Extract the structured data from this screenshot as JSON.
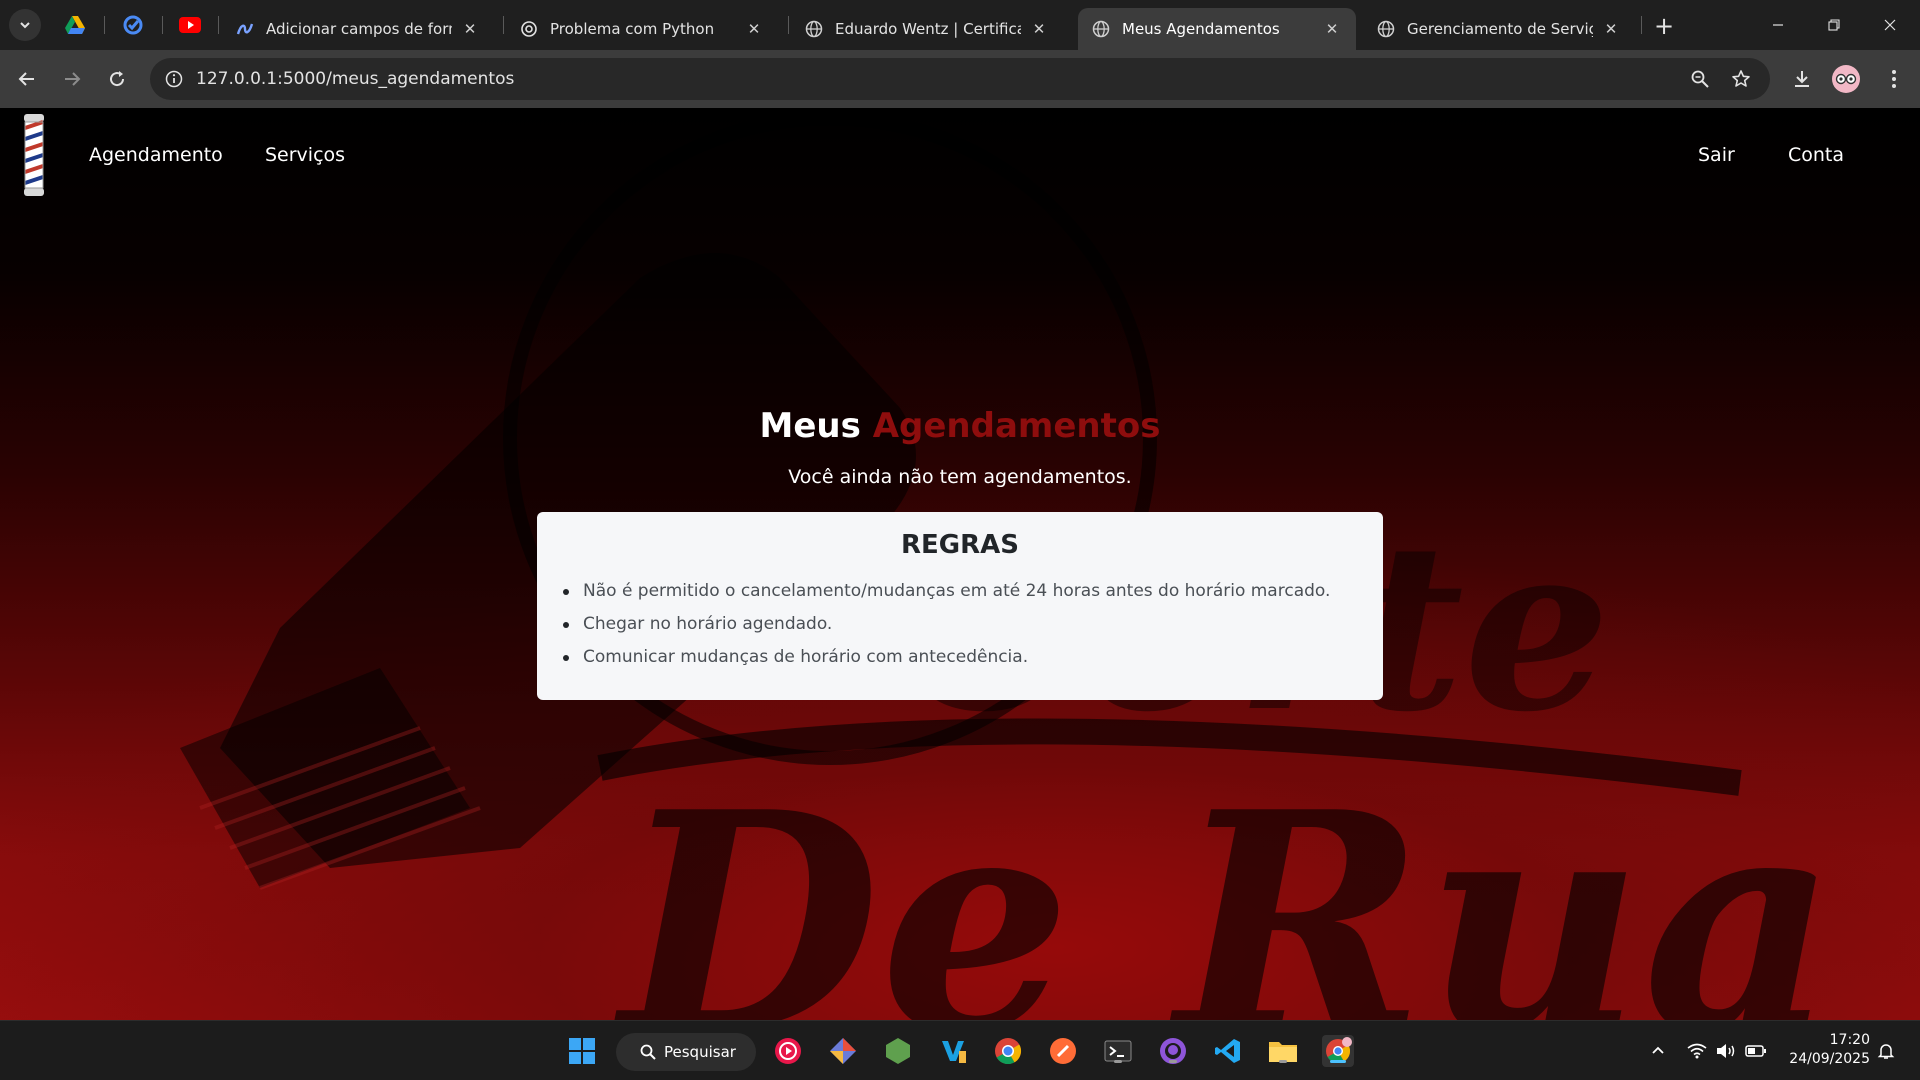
{
  "browser": {
    "tabs": [
      {
        "label": "Adicionar campos de formulá",
        "icon": "chatgpt-style-icon"
      },
      {
        "label": "Problema com Python",
        "icon": "openai-icon"
      },
      {
        "label": "Eduardo Wentz | Certificações",
        "icon": "globe-icon"
      },
      {
        "label": "Meus Agendamentos",
        "icon": "globe-icon",
        "active": true
      },
      {
        "label": "Gerenciamento de Serviços",
        "icon": "globe-icon"
      }
    ],
    "pinned_tabs": [
      "google-drive-icon",
      "google-chrome-check-icon",
      "youtube-icon"
    ],
    "url": "127.0.0.1:5000/meus_agendamentos",
    "close_glyph": "✕",
    "new_tab_glyph": "+"
  },
  "site": {
    "nav": {
      "left": [
        "Agendamento",
        "Serviços"
      ],
      "right": [
        "Sair",
        "Conta"
      ]
    },
    "title_part1": "Meus",
    "title_part2": "Agendamentos",
    "subtitle": "Você ainda não tem agendamentos.",
    "rules": {
      "title": "REGRAS",
      "items": [
        "Não é permitido o cancelamento/mudanças em até 24 horas antes do horário marcado.",
        "Chegar no horário agendado.",
        "Comunicar mudanças de horário com antecedência."
      ]
    },
    "colors": {
      "accent": "#8e0d0d",
      "background_dark": "#000000",
      "background_red": "#9a0e0e"
    }
  },
  "taskbar": {
    "search_label": "Pesquisar",
    "time": "17:20",
    "date": "24/09/2025",
    "apps": [
      "windows-start-icon",
      "search-icon",
      "media-player-icon",
      "git-icon",
      "nodejs-icon",
      "visual-studio-icon",
      "chrome-icon",
      "postman-icon",
      "terminal-icon",
      "github-desktop-icon",
      "vscode-icon",
      "file-explorer-icon",
      "chrome-profile-icon"
    ]
  }
}
